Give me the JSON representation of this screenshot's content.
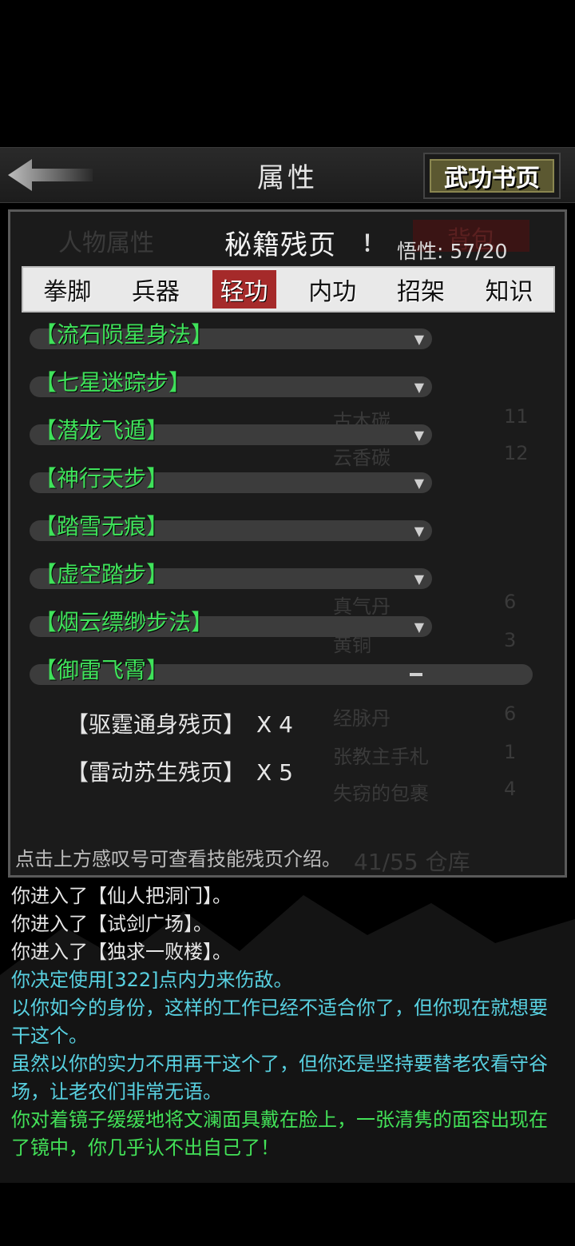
{
  "topbar": {
    "title": "属性",
    "book_button": "武功书页"
  },
  "panel": {
    "title": "秘籍残页",
    "exclaim": "！",
    "insight_label": "悟性:",
    "insight_value": "57/20",
    "tabs": [
      {
        "label": "拳脚",
        "active": false
      },
      {
        "label": "兵器",
        "active": false
      },
      {
        "label": "轻功",
        "active": true
      },
      {
        "label": "内功",
        "active": false
      },
      {
        "label": "招架",
        "active": false
      },
      {
        "label": "知识",
        "active": false
      }
    ],
    "skills": [
      {
        "name": "【流石陨星身法】"
      },
      {
        "name": "【七星迷踪步】"
      },
      {
        "name": "【潜龙飞遁】"
      },
      {
        "name": "【神行天步】"
      },
      {
        "name": "【踏雪无痕】"
      },
      {
        "name": "【虚空踏步】"
      },
      {
        "name": "【烟云缥缈步法】"
      },
      {
        "name": "【御雷飞霄】"
      }
    ],
    "subitems": [
      {
        "name": "【驱霆通身残页】",
        "qty": "X 4"
      },
      {
        "name": "【雷动苏生残页】",
        "qty": "X 5"
      }
    ],
    "hint": "点击上方感叹号可查看技能残页介绍。"
  },
  "background": {
    "tab_left": "人物属性",
    "tab_right": "背包",
    "storage": "41/55 仓库",
    "items": [
      {
        "name": "古木碳",
        "count": "11"
      },
      {
        "name": "云香碳",
        "count": "12"
      },
      {
        "name": "真气丹",
        "count": "6"
      },
      {
        "name": "黄铜",
        "count": "3"
      },
      {
        "name": "经脉丹",
        "count": "6"
      },
      {
        "name": "张教主手札",
        "count": "1"
      },
      {
        "name": "失窃的包裹",
        "count": "4"
      }
    ]
  },
  "log": [
    {
      "text": "你进入了【仙人把洞门】。",
      "color": "#e6e6e6"
    },
    {
      "text": "你进入了【试剑广场】。",
      "color": "#e6e6e6"
    },
    {
      "text": "你进入了【独求一败楼】。",
      "color": "#e6e6e6"
    },
    {
      "text": "你决定使用[322]点内力来伤敌。",
      "color": "#58d0e0"
    },
    {
      "text": "以你如今的身份，这样的工作已经不适合你了，但你现在就想要干这个。",
      "color": "#58d0e0"
    },
    {
      "text": "虽然以你的实力不用再干这个了，但你还是坚持要替老农看守谷场，让老农们非常无语。",
      "color": "#58d0e0"
    },
    {
      "text": "你对着镜子缓缓地将文澜面具戴在脸上，一张清隽的面容出现在了镜中，你几乎认不出自己了！",
      "color": "#43e158"
    }
  ]
}
